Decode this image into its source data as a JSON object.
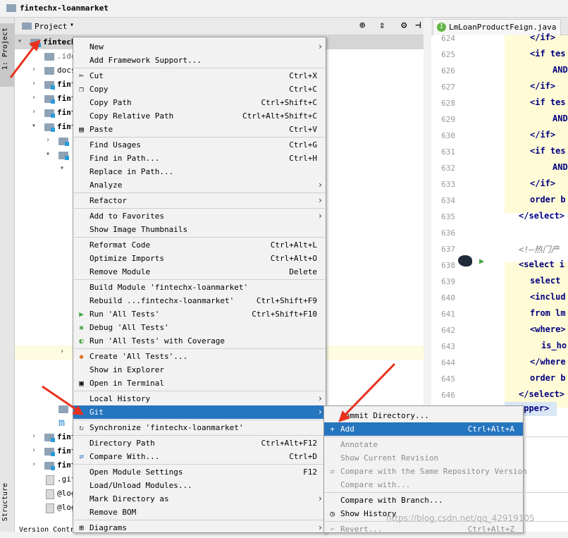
{
  "window": {
    "title": "fintechx-loanmarket"
  },
  "side_tabs": {
    "project": "1: Project",
    "structure": "Structure",
    "version_control": "Version Contr"
  },
  "project_panel": {
    "title": "Project"
  },
  "tree": {
    "root": "fintech",
    "items": [
      ".ide",
      "docs",
      "fint",
      "fint",
      "fint",
      "fint",
      "fint",
      "fint",
      "fint",
      ".git",
      "@log",
      "@log"
    ],
    "module_hint": "m"
  },
  "editor": {
    "tab": "LmLoanProductFeign.java",
    "lines": [
      {
        "n": "624",
        "code": "</if>"
      },
      {
        "n": "625",
        "code": "<if tes"
      },
      {
        "n": "626",
        "code": "AND"
      },
      {
        "n": "627",
        "code": "</if>"
      },
      {
        "n": "628",
        "code": "<if tes"
      },
      {
        "n": "629",
        "code": "AND"
      },
      {
        "n": "630",
        "code": "</if>"
      },
      {
        "n": "631",
        "code": "<if tes"
      },
      {
        "n": "632",
        "code": "AND"
      },
      {
        "n": "633",
        "code": "</if>"
      },
      {
        "n": "634",
        "code": "order b"
      },
      {
        "n": "635",
        "code": "</select>"
      },
      {
        "n": "636",
        "code": ""
      },
      {
        "n": "637",
        "code": "<!—热门产"
      },
      {
        "n": "638",
        "code": "<select i"
      },
      {
        "n": "639",
        "code": "select"
      },
      {
        "n": "640",
        "code": "<includ"
      },
      {
        "n": "641",
        "code": "from lm"
      },
      {
        "n": "642",
        "code": "<where>"
      },
      {
        "n": "643",
        "code": "is_ho"
      },
      {
        "n": "644",
        "code": "</where"
      },
      {
        "n": "645",
        "code": "order b"
      },
      {
        "n": "646",
        "code": "</select>"
      }
    ],
    "mapper_tail": "apper>"
  },
  "context_menu": {
    "items": [
      {
        "label": "New",
        "shortcut": "",
        "sub": true
      },
      {
        "label": "Add Framework Support...",
        "shortcut": ""
      },
      {
        "label": "Cut",
        "shortcut": "Ctrl+X",
        "icon": "scissors-icon"
      },
      {
        "label": "Copy",
        "shortcut": "Ctrl+C",
        "icon": "copy-icon"
      },
      {
        "label": "Copy Path",
        "shortcut": "Ctrl+Shift+C"
      },
      {
        "label": "Copy Relative Path",
        "shortcut": "Ctrl+Alt+Shift+C"
      },
      {
        "label": "Paste",
        "shortcut": "Ctrl+V",
        "icon": "paste-icon"
      },
      {
        "label": "Find Usages",
        "shortcut": "Ctrl+G"
      },
      {
        "label": "Find in Path...",
        "shortcut": "Ctrl+H"
      },
      {
        "label": "Replace in Path...",
        "shortcut": ""
      },
      {
        "label": "Analyze",
        "shortcut": "",
        "sub": true
      },
      {
        "label": "Refactor",
        "shortcut": "",
        "sub": true
      },
      {
        "label": "Add to Favorites",
        "shortcut": "",
        "sub": true
      },
      {
        "label": "Show Image Thumbnails",
        "shortcut": ""
      },
      {
        "label": "Reformat Code",
        "shortcut": "Ctrl+Alt+L"
      },
      {
        "label": "Optimize Imports",
        "shortcut": "Ctrl+Alt+O"
      },
      {
        "label": "Remove Module",
        "shortcut": "Delete"
      },
      {
        "label": "Build Module 'fintechx-loanmarket'",
        "shortcut": ""
      },
      {
        "label": "Rebuild ...fintechx-loanmarket'",
        "shortcut": "Ctrl+Shift+F9"
      },
      {
        "label": "Run 'All Tests'",
        "shortcut": "Ctrl+Shift+F10",
        "icon": "run-icon"
      },
      {
        "label": "Debug 'All Tests'",
        "shortcut": "",
        "icon": "debug-icon"
      },
      {
        "label": "Run 'All Tests' with Coverage",
        "shortcut": "",
        "icon": "coverage-icon"
      },
      {
        "label": "Create 'All Tests'...",
        "shortcut": "",
        "icon": "create-test-icon"
      },
      {
        "label": "Show in Explorer",
        "shortcut": ""
      },
      {
        "label": "Open in Terminal",
        "shortcut": "",
        "icon": "terminal-icon"
      },
      {
        "label": "Local History",
        "shortcut": "",
        "sub": true
      },
      {
        "label": "Git",
        "shortcut": "",
        "sub": true,
        "selected": true
      },
      {
        "label": "Synchronize 'fintechx-loanmarket'",
        "shortcut": "",
        "icon": "sync-icon"
      },
      {
        "label": "Directory Path",
        "shortcut": "Ctrl+Alt+F12"
      },
      {
        "label": "Compare With...",
        "shortcut": "Ctrl+D",
        "icon": "compare-icon"
      },
      {
        "label": "Open Module Settings",
        "shortcut": "F12"
      },
      {
        "label": "Load/Unload Modules...",
        "shortcut": ""
      },
      {
        "label": "Mark Directory as",
        "shortcut": "",
        "sub": true
      },
      {
        "label": "Remove BOM",
        "shortcut": ""
      },
      {
        "label": "Diagrams",
        "shortcut": "",
        "sub": true,
        "icon": "diagram-icon"
      }
    ]
  },
  "git_menu": {
    "items": [
      {
        "label": "Commit Directory...",
        "shortcut": ""
      },
      {
        "label": "Add",
        "shortcut": "Ctrl+Alt+A",
        "selected": true,
        "icon": "plus-icon"
      },
      {
        "label": "Annotate",
        "shortcut": "",
        "disabled": true
      },
      {
        "label": "Show Current Revision",
        "shortcut": "",
        "disabled": true
      },
      {
        "label": "Compare with the Same Repository Version",
        "shortcut": "",
        "disabled": true,
        "icon": "compare-icon"
      },
      {
        "label": "Compare with...",
        "shortcut": "",
        "disabled": true
      },
      {
        "label": "Compare with Branch...",
        "shortcut": ""
      },
      {
        "label": "Show History",
        "shortcut": "",
        "icon": "history-icon"
      },
      {
        "label": "Revert...",
        "shortcut": "Ctrl+Alt+Z",
        "disabled": true,
        "icon": "revert-icon"
      }
    ]
  },
  "watermark": "https://blog.csdn.net/qq_42919105",
  "colors": {
    "selection": "#2675bf",
    "annotation_arrow": "#e8321e"
  }
}
